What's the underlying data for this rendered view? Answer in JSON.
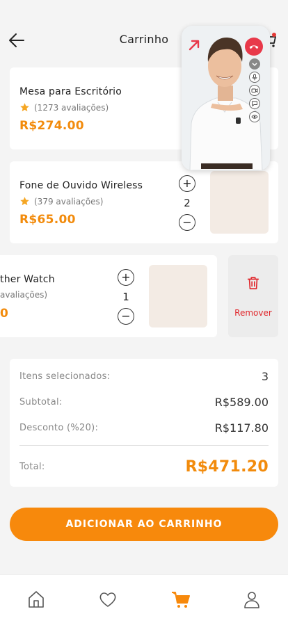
{
  "header": {
    "title": "Carrinho"
  },
  "items": [
    {
      "name": "Mesa para Escritório",
      "rating": "(1273 avaliações)",
      "price": "R$274.00"
    },
    {
      "name": "Fone de Ouvido Wireless",
      "rating": "(379 avaliações)",
      "price": "R$65.00",
      "quantity": "2"
    },
    {
      "name": "Leather Watch",
      "name_visible": "ther Watch",
      "rating_visible": "avaliações)",
      "price_visible": "0",
      "quantity": "1"
    }
  ],
  "remove": {
    "label": "Remover"
  },
  "summary": {
    "items_label": "Itens selecionados:",
    "items_value": "3",
    "subtotal_label": "Subtotal:",
    "subtotal_value": "R$589.00",
    "discount_label": "Desconto (%20):",
    "discount_value": "R$117.80",
    "total_label": "Total:",
    "total_value": "R$471.20"
  },
  "cta": {
    "label": "ADICIONAR AO CARRINHO"
  },
  "tabs": {
    "active": "cart"
  },
  "colors": {
    "accent": "#f7890c",
    "danger": "#e0262b",
    "thumb": "#f3ebe4"
  }
}
